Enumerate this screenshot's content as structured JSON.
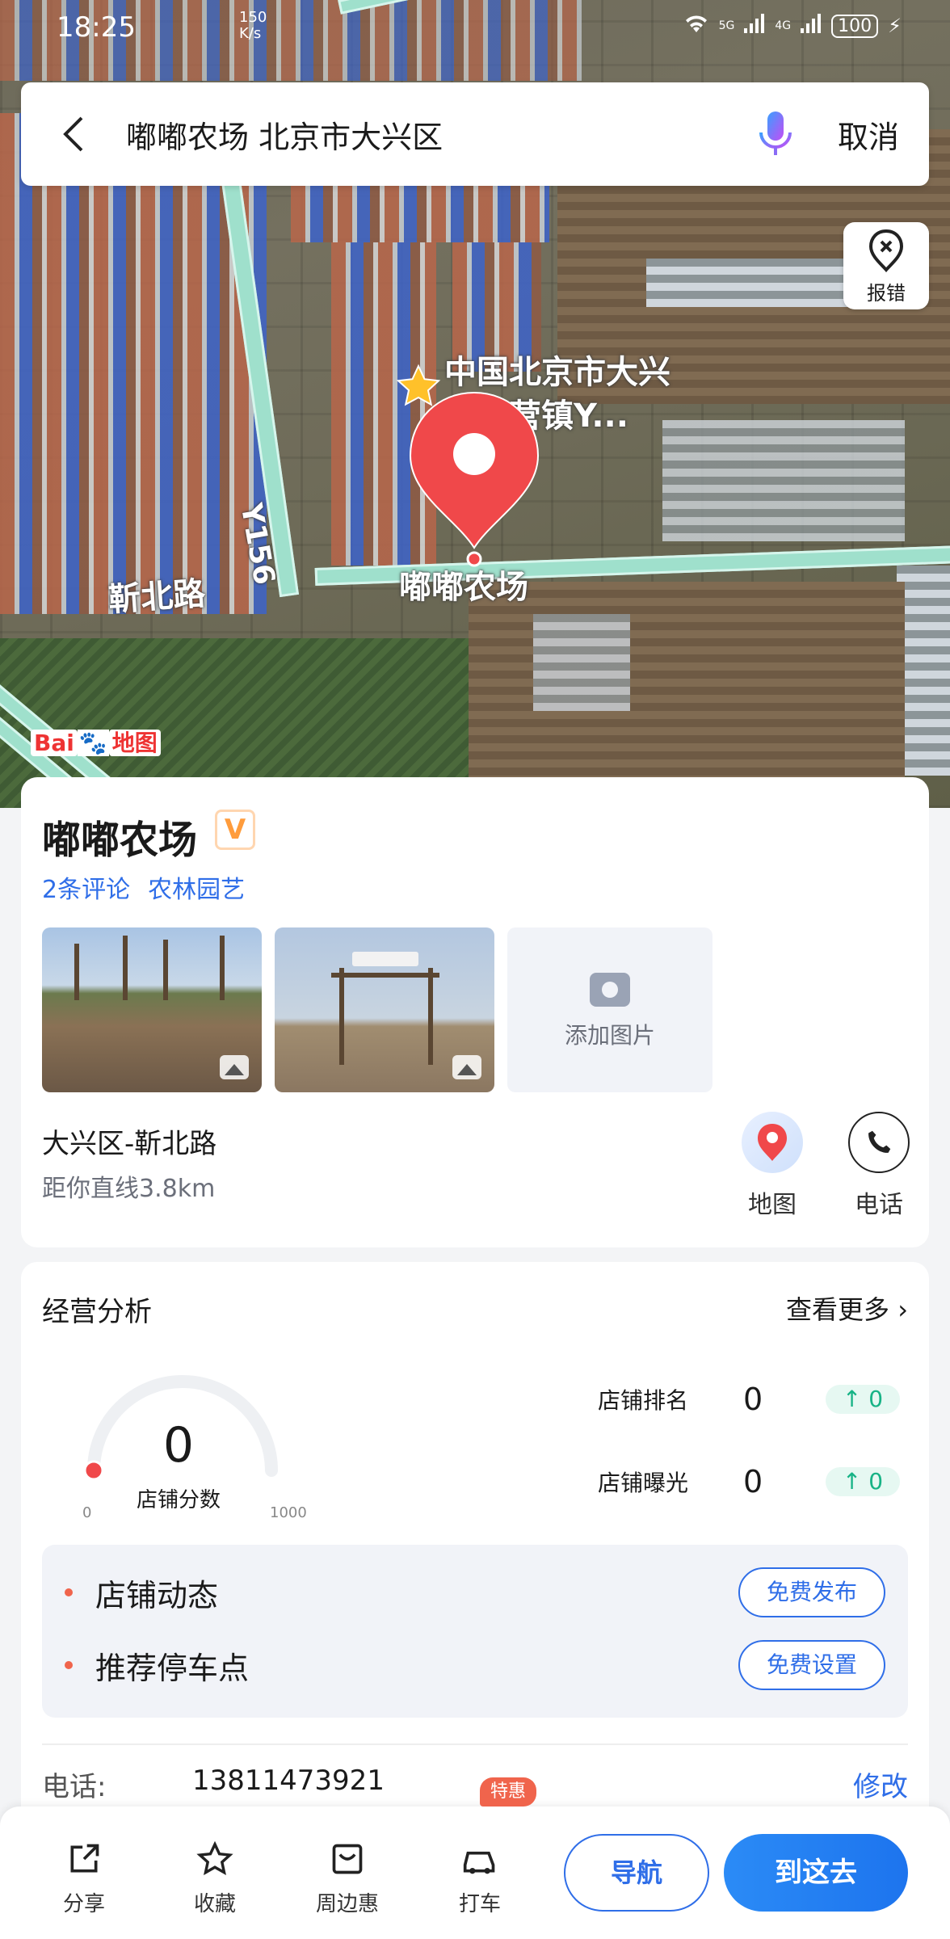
{
  "status_bar": {
    "time": "18:25",
    "speed_value": "150",
    "speed_unit": "K/s",
    "network_1": "5G",
    "network_2": "4G",
    "battery": "100"
  },
  "search": {
    "query": "嘟嘟农场 北京市大兴区",
    "cancel_label": "取消"
  },
  "map": {
    "report_label": "报错",
    "poi_label_line1": "中国北京市大兴",
    "poi_label_line2": "子营镇Y...",
    "place_label": "嘟嘟农场",
    "road_label": "靳北路",
    "route_label": "Y156",
    "logo_text_1": "Bai",
    "logo_text_2": "地图"
  },
  "place": {
    "name": "嘟嘟农场",
    "verified_icon": "v-badge",
    "reviews": "2条评论",
    "category": "农林园艺",
    "add_photo_label": "添加图片",
    "address": "大兴区-靳北路",
    "distance": "距你直线3.8km",
    "map_label": "地图",
    "phone_label": "电话"
  },
  "analysis": {
    "title": "经营分析",
    "more_label": "查看更多",
    "score_value": "0",
    "score_caption": "店铺分数",
    "score_min": "0",
    "score_max": "1000",
    "score_fraction": 0,
    "stats": [
      {
        "label": "店铺排名",
        "value": "0",
        "change": "0"
      },
      {
        "label": "店铺曝光",
        "value": "0",
        "change": "0"
      }
    ],
    "tasks": [
      {
        "label": "店铺动态",
        "button": "免费发布"
      },
      {
        "label": "推荐停车点",
        "button": "免费设置"
      }
    ],
    "phone_key": "电话:",
    "phone_value": "13811473921",
    "edit_label": "修改"
  },
  "bottom_bar": {
    "share": "分享",
    "favorite": "收藏",
    "nearby": "周边惠",
    "taxi": "打车",
    "taxi_badge": "特惠",
    "navigate": "导航",
    "go_here": "到这去"
  },
  "colors": {
    "accent": "#2f6ee8",
    "pin": "#f0484a",
    "go_button": "#1d74ee",
    "up_green": "#17b386"
  }
}
